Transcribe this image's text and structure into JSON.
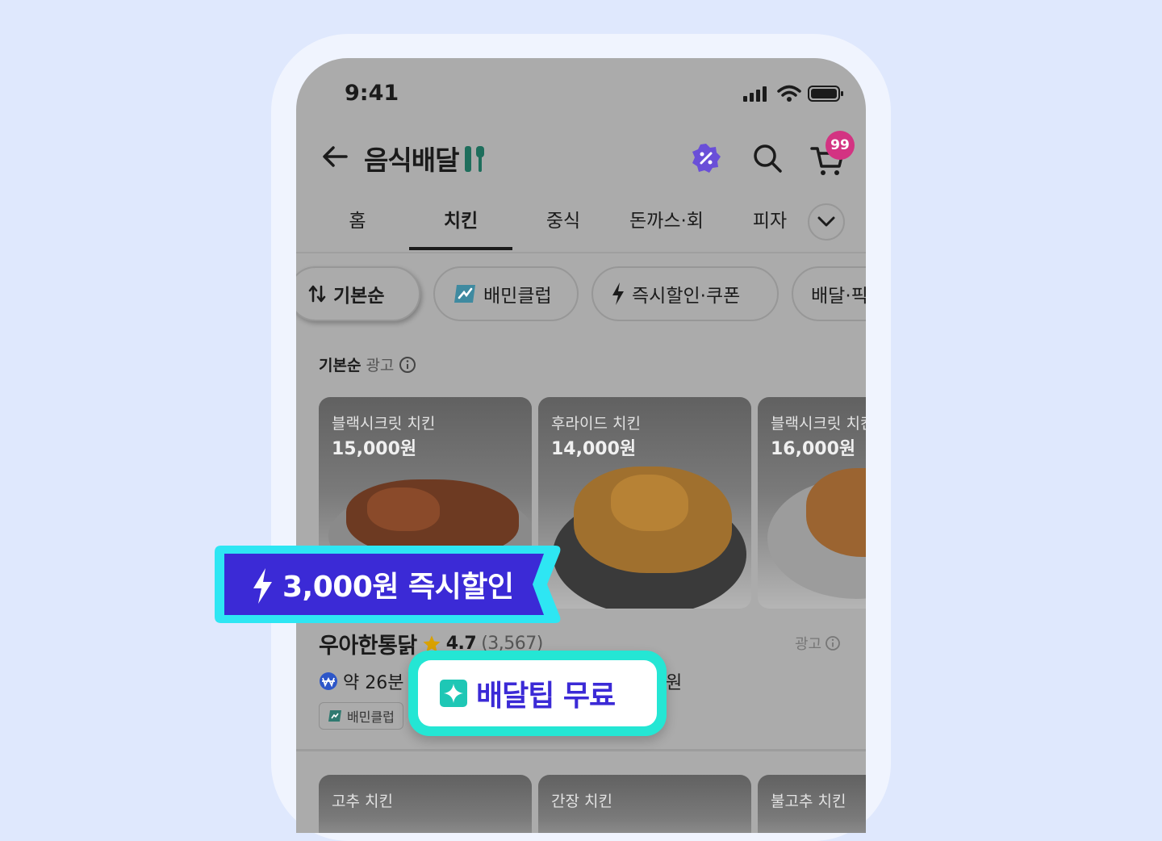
{
  "status_bar": {
    "time": "9:41"
  },
  "header": {
    "title": "음식배달",
    "cart_count": "99"
  },
  "tabs": [
    {
      "label": "홈",
      "active": false
    },
    {
      "label": "치킨",
      "active": true
    },
    {
      "label": "중식",
      "active": false
    },
    {
      "label": "돈까스·회",
      "active": false
    },
    {
      "label": "피자",
      "active": false
    }
  ],
  "filters": {
    "sort": "기본순",
    "club": "배민클럽",
    "discount": "즉시할인·쿠폰",
    "delivery": "배달·픽"
  },
  "section": {
    "title": "기본순",
    "ad_label": "광고"
  },
  "menu_cards": [
    {
      "name": "블랙시크릿 치킨",
      "price": "15,000원"
    },
    {
      "name": "후라이드 치킨",
      "price": "14,000원"
    },
    {
      "name": "블랙시크릿 치킨",
      "price": "16,000원"
    }
  ],
  "store": {
    "name": "우아한통닭",
    "rating": "4.7",
    "review_count": "(3,567)",
    "ad_label": "광고",
    "delivery_time": "약 26분",
    "delivery_suffix": "원",
    "club_badge": "배민클럽"
  },
  "next_cards": [
    {
      "name": "고추 치킨"
    },
    {
      "name": "간장 치킨"
    },
    {
      "name": "불고추 치킨"
    }
  ],
  "callouts": {
    "discount": "3,000원 즉시할인",
    "tip": "배달팁 무료"
  },
  "colors": {
    "accent_purple": "#3b2ad6",
    "accent_mint": "#24e6d4",
    "badge_pink": "#d33382"
  }
}
